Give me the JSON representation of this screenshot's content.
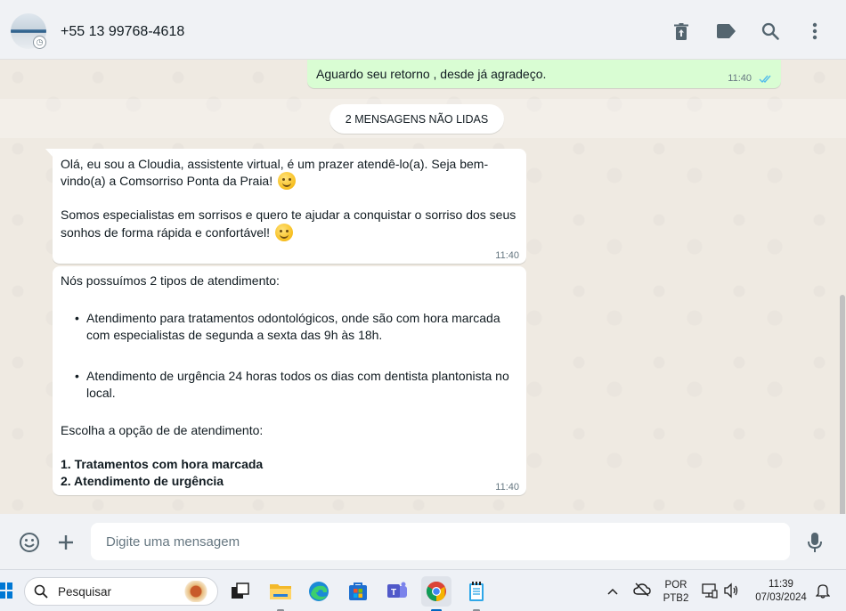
{
  "header": {
    "contact_name": "+55 13 99768-4618",
    "icons": [
      "delete-icon",
      "label-icon",
      "search-icon",
      "menu-icon"
    ]
  },
  "messages": {
    "outgoing": {
      "text": "Aguardo seu retorno , desde já agradeço.",
      "time": "11:40",
      "status": "read"
    },
    "unread_label": "2 MENSAGENS NÃO LIDAS",
    "incoming": [
      {
        "lines": [
          "Olá, eu sou a Cloudia, assistente virtual, é um prazer atendê-lo(a). Seja bem-",
          "vindo(a) a Comsorriso Ponta da Praia!",
          "Somos especialistas em sorrisos e quero te ajudar a conquistar o sorriso dos seus",
          "sonhos de forma rápida e confortável!"
        ],
        "time": "11:40"
      },
      {
        "intro": "Nós possuímos 2 tipos de atendimento:",
        "bullets": [
          {
            "line1": "Atendimento para tratamentos odontológicos, onde são com hora marcada",
            "line2": "com especialistas de segunda a sexta das 9h às 18h."
          },
          {
            "line1": "Atendimento de urgência 24 horas todos os dias com dentista plantonista no",
            "line2": "local."
          }
        ],
        "prompt": "Escolha a opção de de atendimento:",
        "options": [
          "1. Tratamentos com hora marcada",
          "2. Atendimento de urgência"
        ],
        "time": "11:40"
      }
    ]
  },
  "composer": {
    "placeholder": "Digite uma mensagem",
    "icons": [
      "emoji-icon",
      "plus-icon",
      "microphone-icon"
    ]
  },
  "taskbar": {
    "search_label": "Pesquisar",
    "apps": [
      "task-view",
      "file-explorer",
      "edge",
      "microsoft-store",
      "teams",
      "chrome",
      "notepad"
    ],
    "lang_line1": "POR",
    "lang_line2": "PTB2",
    "time": "11:39",
    "date": "07/03/2024"
  },
  "colors": {
    "outgoing_bubble": "#d9fdd3",
    "incoming_bubble": "#ffffff",
    "chat_background": "#efeae2",
    "read_ticks": "#53bdeb",
    "header_background": "#f0f2f5"
  }
}
